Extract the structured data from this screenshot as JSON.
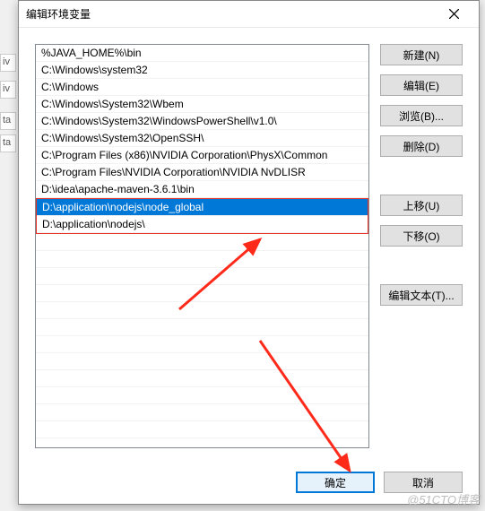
{
  "dialog": {
    "title": "编辑环境变量",
    "close_icon": "close"
  },
  "list": {
    "items": [
      "%JAVA_HOME%\\bin",
      "C:\\Windows\\system32",
      "C:\\Windows",
      "C:\\Windows\\System32\\Wbem",
      "C:\\Windows\\System32\\WindowsPowerShell\\v1.0\\",
      "C:\\Windows\\System32\\OpenSSH\\",
      "C:\\Program Files (x86)\\NVIDIA Corporation\\PhysX\\Common",
      "C:\\Program Files\\NVIDIA Corporation\\NVIDIA NvDLISR",
      "D:\\idea\\apache-maven-3.6.1\\bin",
      "D:\\application\\nodejs\\node_global",
      "D:\\application\\nodejs\\"
    ],
    "selected_index": 9,
    "highlight_range": [
      9,
      10
    ]
  },
  "buttons": {
    "new": "新建(N)",
    "edit": "编辑(E)",
    "browse": "浏览(B)...",
    "delete": "删除(D)",
    "moveup": "上移(U)",
    "movedown": "下移(O)",
    "edittext": "编辑文本(T)...",
    "ok": "确定",
    "cancel": "取消"
  },
  "watermark": "@51CTO博客",
  "bg_fragments": [
    "iv",
    "iv",
    "ta",
    "ta"
  ]
}
